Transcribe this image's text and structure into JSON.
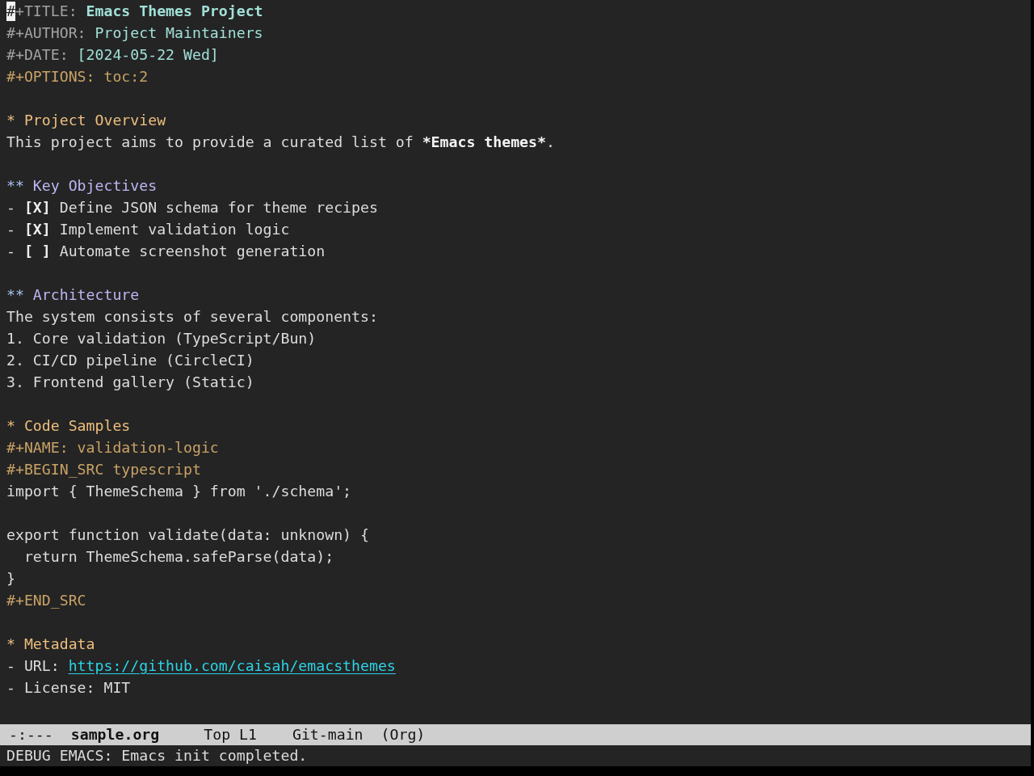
{
  "editor": {
    "keywords": [
      {
        "kind": "title",
        "key": "#+TITLE:",
        "value": "Emacs Themes Project",
        "cursor": true
      },
      {
        "kind": "info",
        "key": "#+AUTHOR:",
        "value": "Project Maintainers",
        "cursor": false
      },
      {
        "kind": "info",
        "key": "#+DATE:",
        "value": "[2024-05-22 Wed]",
        "cursor": false
      },
      {
        "kind": "option",
        "key": "#+OPTIONS:",
        "value": "toc:2",
        "cursor": false
      }
    ],
    "sections": [
      {
        "stars": "*",
        "title": "Project Overview",
        "blocks": [
          {
            "kind": "paragraph",
            "segments": [
              {
                "kind": "plain",
                "text": "This project aims to provide a curated list of "
              },
              {
                "kind": "bold",
                "text": "*Emacs themes*"
              },
              {
                "kind": "plain",
                "text": "."
              }
            ]
          }
        ],
        "children": [
          {
            "stars": "**",
            "title": "Key Objectives",
            "blocks": [
              {
                "kind": "checklist",
                "items": [
                  {
                    "bullet": "-",
                    "checkbox": "[X]",
                    "text": "Define JSON schema for theme recipes"
                  },
                  {
                    "bullet": "-",
                    "checkbox": "[X]",
                    "text": "Implement validation logic"
                  },
                  {
                    "bullet": "-",
                    "checkbox": "[ ]",
                    "text": "Automate screenshot generation"
                  }
                ]
              }
            ]
          },
          {
            "stars": "**",
            "title": "Architecture",
            "blocks": [
              {
                "kind": "paragraph",
                "segments": [
                  {
                    "kind": "plain",
                    "text": "The system consists of several components:"
                  }
                ]
              },
              {
                "kind": "ordered_list",
                "items": [
                  {
                    "number": "1.",
                    "text": "Core validation (TypeScript/Bun)"
                  },
                  {
                    "number": "2.",
                    "text": "CI/CD pipeline (CircleCI)"
                  },
                  {
                    "number": "3.",
                    "text": "Frontend gallery (Static)"
                  }
                ]
              }
            ]
          }
        ]
      },
      {
        "stars": "*",
        "title": "Code Samples",
        "blocks": [
          {
            "kind": "keyword",
            "key": "#+NAME:",
            "value": "validation-logic"
          },
          {
            "kind": "src",
            "begin": "#+BEGIN_SRC",
            "language": "typescript",
            "code": "import { ThemeSchema } from './schema';\n\nexport function validate(data: unknown) {\n  return ThemeSchema.safeParse(data);\n}",
            "end": "#+END_SRC"
          }
        ]
      },
      {
        "stars": "*",
        "title": "Metadata",
        "blocks": [
          {
            "kind": "fields",
            "items": [
              {
                "kind": "link",
                "bullet": "-",
                "label": "URL:",
                "value": "https://github.com/caisah/emacsthemes"
              },
              {
                "kind": "plain",
                "bullet": "-",
                "label": "License:",
                "value": "MIT"
              }
            ]
          }
        ]
      }
    ]
  },
  "mode_line": {
    "segments": [
      {
        "kind": "status",
        "text": "-:---"
      },
      {
        "kind": "buffer",
        "text": "sample.org"
      },
      {
        "kind": "position",
        "text": "Top L1"
      },
      {
        "kind": "branch",
        "text": "Git-main"
      },
      {
        "kind": "mode",
        "text": "(Org)"
      }
    ]
  },
  "echo_area": {
    "message": "DEBUG EMACS: Emacs init completed."
  }
}
